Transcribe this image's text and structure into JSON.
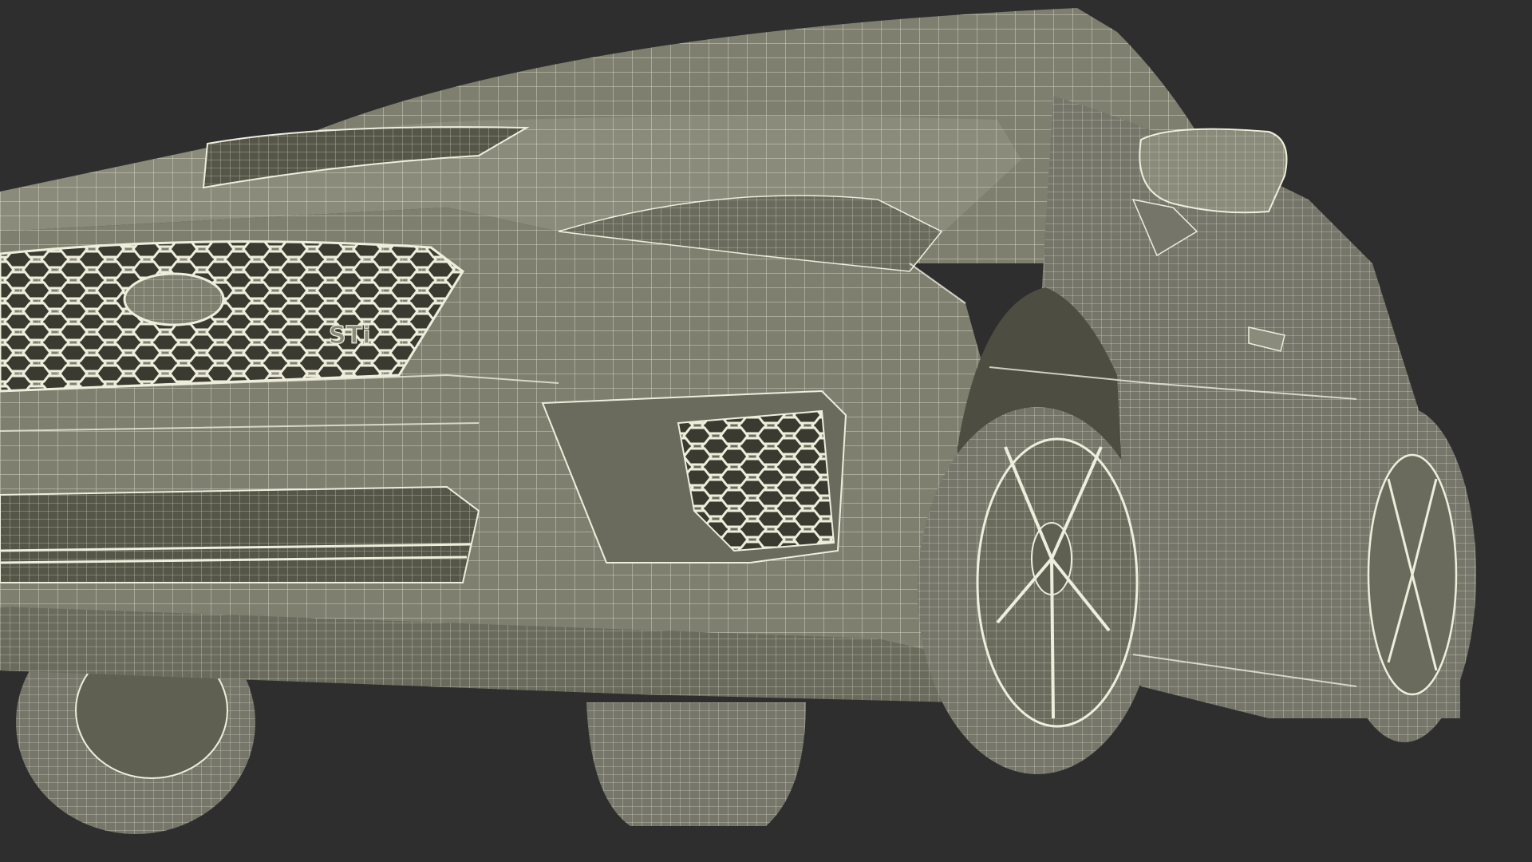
{
  "scene": {
    "subject": "car-wireframe-render",
    "badge_text": "STi",
    "colors": {
      "background": "#2e2e2e",
      "body_fill": "#7f7f70",
      "body_fill_dark": "#6b6b5d",
      "body_fill_light": "#8b8b7b",
      "opening_fill": "#555548",
      "tire_fill": "#76766a",
      "wire": "#efeedd"
    }
  }
}
